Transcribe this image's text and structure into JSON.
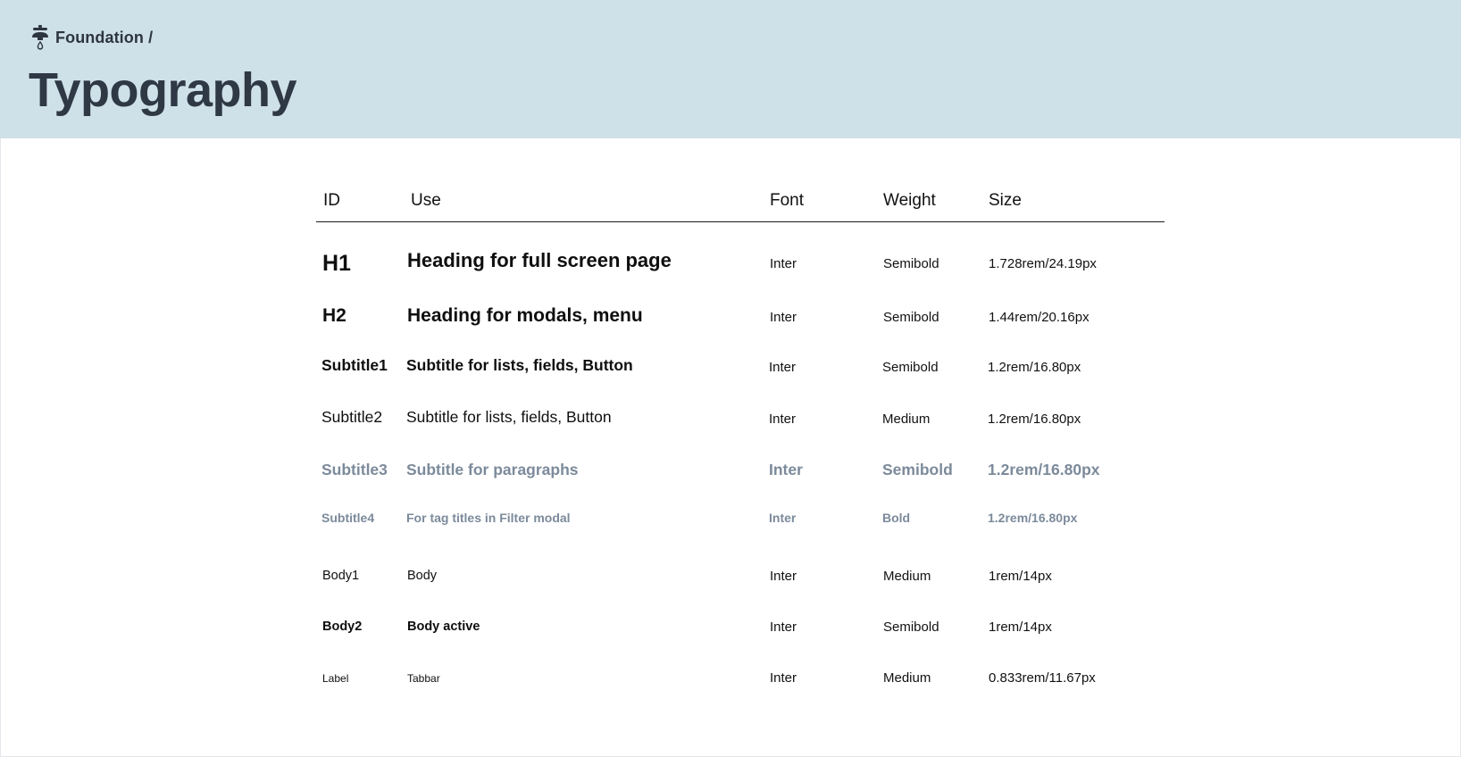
{
  "breadcrumb": {
    "icon": "faucet-icon",
    "label": "Foundation /"
  },
  "page_title": "Typography",
  "table": {
    "headers": {
      "id": "ID",
      "use": "Use",
      "font": "Font",
      "weight": "Weight",
      "size": "Size"
    },
    "rows": [
      {
        "id": "H1",
        "use": "Heading for full screen page",
        "font": "Inter",
        "weight": "Semibold",
        "size": "1.728rem/24.19px"
      },
      {
        "id": "H2",
        "use": "Heading for modals, menu",
        "font": "Inter",
        "weight": "Semibold",
        "size": "1.44rem/20.16px"
      },
      {
        "id": "Subtitle1",
        "use": "Subtitle for lists, fields, Button",
        "font": "Inter",
        "weight": "Semibold",
        "size": "1.2rem/16.80px"
      },
      {
        "id": "Subtitle2",
        "use": "Subtitle for lists, fields, Button",
        "font": "Inter",
        "weight": "Medium",
        "size": "1.2rem/16.80px"
      },
      {
        "id": "Subtitle3",
        "use": "Subtitle for paragraphs",
        "font": "Inter",
        "weight": "Semibold",
        "size": "1.2rem/16.80px"
      },
      {
        "id": "Subtitle4",
        "use": "For tag titles in Filter modal",
        "font": "Inter",
        "weight": "Bold",
        "size": "1.2rem/16.80px"
      },
      {
        "id": "Body1",
        "use": "Body",
        "font": "Inter",
        "weight": "Medium",
        "size": "1rem/14px"
      },
      {
        "id": "Body2",
        "use": "Body active",
        "font": "Inter",
        "weight": "Semibold",
        "size": "1rem/14px"
      },
      {
        "id": "Label",
        "use": "Tabbar",
        "font": "Inter",
        "weight": "Medium",
        "size": "0.833rem/11.67px"
      }
    ]
  },
  "colors": {
    "header_bg": "#cfe1e8",
    "muted_text": "#7c8a9b",
    "title_text": "#2f3845"
  }
}
